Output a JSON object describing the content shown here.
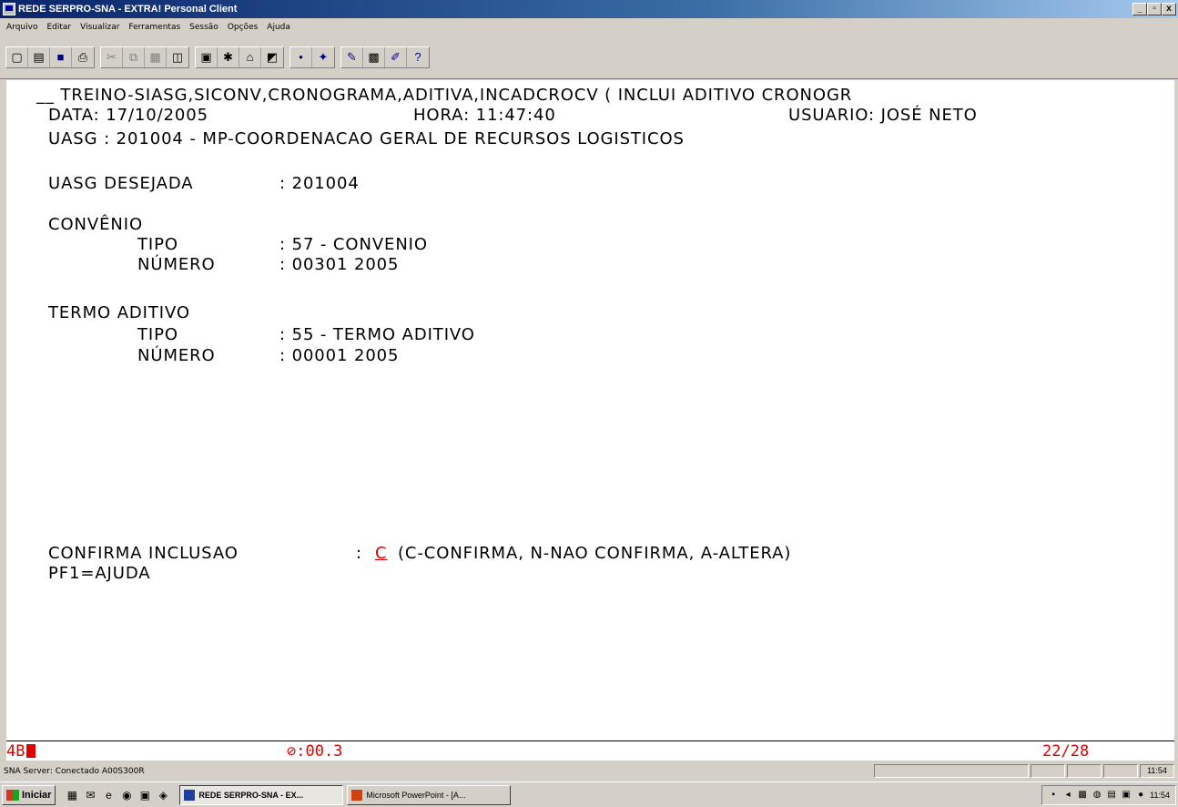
{
  "window": {
    "title": "REDE SERPRO-SNA - EXTRA! Personal Client",
    "controls": [
      "_",
      "▫",
      "x"
    ]
  },
  "menu": [
    "Arquivo",
    "Editar",
    "Visualizar",
    "Ferramentas",
    "Sessão",
    "Opções",
    "Ajuda"
  ],
  "toolbar_icons": [
    [
      "new-icon",
      "open-icon",
      "save-icon",
      "print-icon"
    ],
    [
      "cut-icon",
      "copy-icon",
      "paste-icon",
      "select-icon"
    ],
    [
      "edit-icon",
      "tools-icon",
      "macro-icon",
      "settings-icon"
    ],
    [
      "connect-icon",
      "disconnect-icon"
    ],
    [
      "properties-icon",
      "display-icon",
      "keyboard-icon",
      "help-icon"
    ]
  ],
  "terminal": {
    "line1": "__ TREINO-SIASG,SICONV,CRONOGRAMA,ADITIVA,INCADCROCV ( INCLUI ADITIVO CRONOGR",
    "data_label": "DATA: 17/10/2005",
    "hora_label": "HORA: 11:47:40",
    "usuario_label": "USUARIO: JOSÉ NETO",
    "uasg_line": "UASG : 201004 - MP-COORDENACAO GERAL DE RECURSOS LOGISTICOS",
    "uasg_desejada_label": "UASG DESEJADA",
    "uasg_desejada_value": ": 201004",
    "convenio_header": "CONVÊNIO",
    "convenio_tipo_label": "TIPO",
    "convenio_tipo_value": ": 57 - CONVENIO",
    "convenio_numero_label": "NÚMERO",
    "convenio_numero_value": ": 00301 2005",
    "termo_header": "TERMO ADITIVO",
    "termo_tipo_label": "TIPO",
    "termo_tipo_value": ": 55 - TERMO ADITIVO",
    "termo_numero_label": "NÚMERO",
    "termo_numero_value": ": 00001 2005",
    "confirma_label": "CONFIRMA INCLUSAO",
    "confirma_colon": ":",
    "confirma_input": "C",
    "confirma_options": "(C-CONFIRMA, N-NAO CONFIRMA, A-ALTERA)",
    "pf1": "PF1=AJUDA"
  },
  "oia": {
    "indicator": "4B",
    "timer": "⊘:00.3",
    "cursor_pos": "22/28"
  },
  "status": {
    "text": "SNA Server: Conectado A00S300R",
    "time": "11:54"
  },
  "taskbar": {
    "start": "Iniciar",
    "tasks": [
      "REDE SERPRO-SNA - EX...",
      "Microsoft PowerPoint - [A..."
    ],
    "clock": "11:54"
  },
  "colors": {
    "titlebar": "#0a246a",
    "terminal_bg": "#ffffff",
    "terminal_text": "#000000",
    "input_red": "#e00000"
  }
}
